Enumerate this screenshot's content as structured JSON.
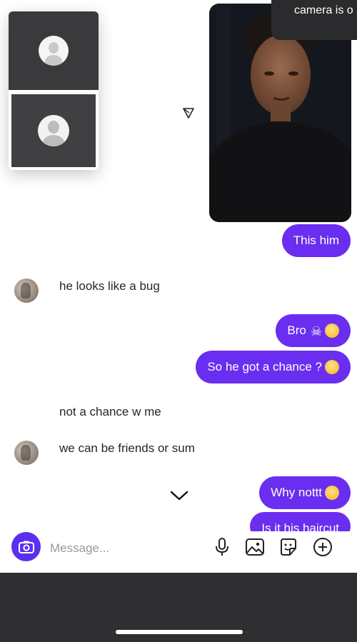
{
  "notification": {
    "text": "camera is o"
  },
  "messages": {
    "m1": "This him",
    "m2": "he looks like a bug",
    "m3": "Bro",
    "m4": "So he got a chance ?",
    "m5": "not a chance w me",
    "m6": "we can be friends or sum",
    "m7": "Why nottt",
    "m8": "Is it his haircut"
  },
  "composer": {
    "placeholder": "Message..."
  },
  "colors": {
    "accent": "#6a2ef0",
    "camera_button": "#5b2ff0",
    "bottom_bar": "#2f2f31"
  },
  "icons": [
    "send-arrow-icon",
    "chevron-down-icon",
    "camera-icon",
    "microphone-icon",
    "gallery-icon",
    "sticker-icon",
    "plus-icon"
  ]
}
